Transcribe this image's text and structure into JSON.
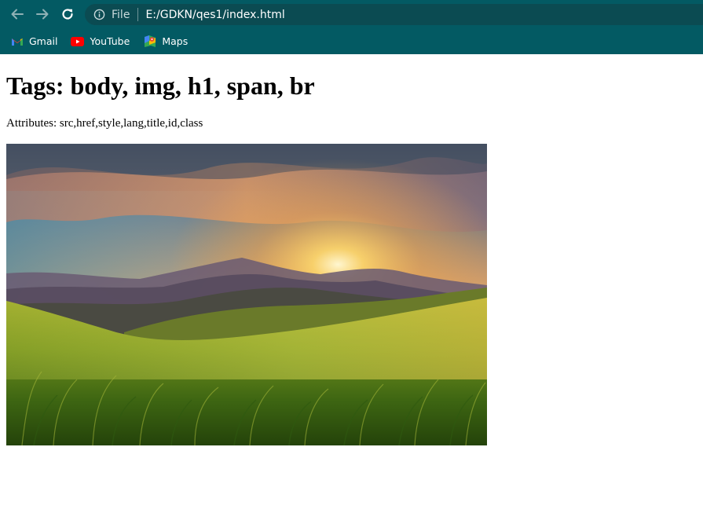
{
  "browser": {
    "nav": {
      "back_icon": "arrow-left-icon",
      "forward_icon": "arrow-right-icon",
      "reload_icon": "reload-icon"
    },
    "omnibox": {
      "security_icon": "info-icon",
      "scheme_label": "File",
      "url": "E:/GDKN/qes1/index.html"
    },
    "bookmarks": [
      {
        "label": "Gmail",
        "icon": "gmail-icon"
      },
      {
        "label": "YouTube",
        "icon": "youtube-icon"
      },
      {
        "label": "Maps",
        "icon": "maps-icon"
      }
    ],
    "colors": {
      "toolbar": "#035a63",
      "omnibox": "#0b4b52"
    }
  },
  "page": {
    "heading": "Tags: body, img, h1, span, br",
    "attributes_text": "Attributes: src,href,style,lang,title,id,class",
    "image": {
      "subject": "mountain-sunrise-photo"
    }
  }
}
